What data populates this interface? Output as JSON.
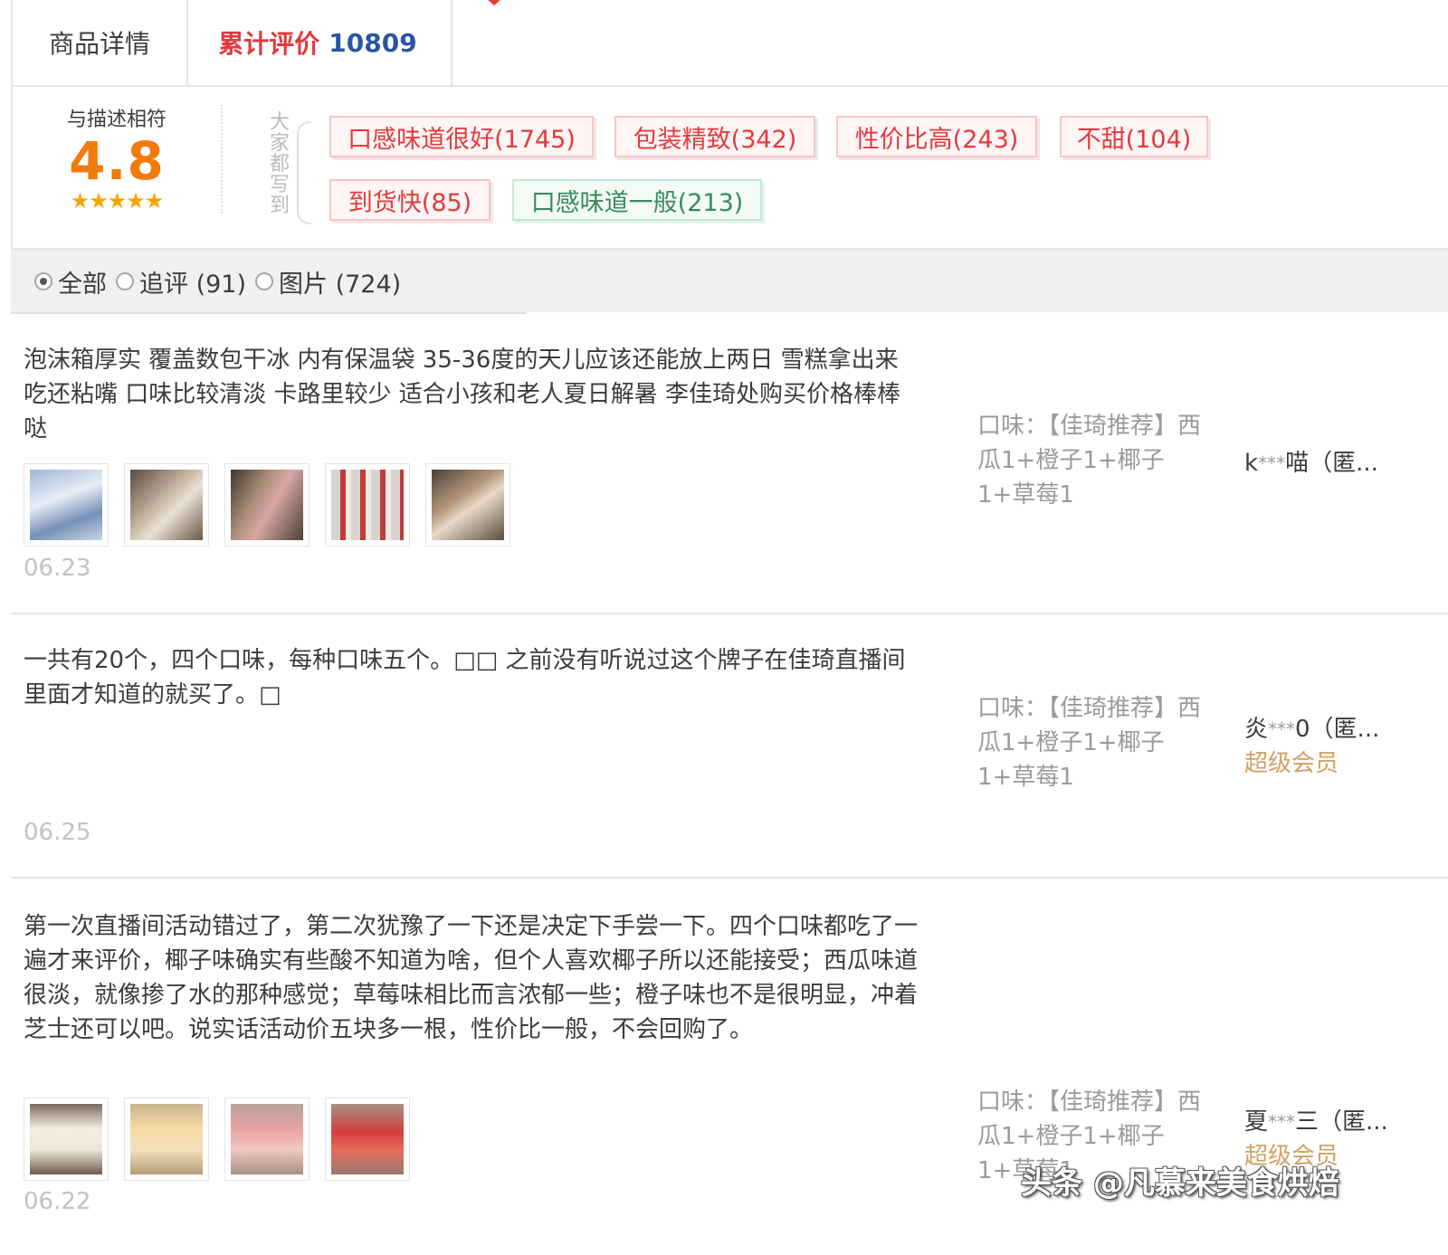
{
  "tabs": {
    "details_label": "商品详情",
    "reviews_label": "累计评价",
    "reviews_count": "10809"
  },
  "summary": {
    "score_label": "与描述相符",
    "score": "4.8",
    "stars": "★★★★★",
    "side_label": "大家都写到",
    "tags": [
      {
        "label": "口感味道很好(1745)",
        "sentiment": "positive"
      },
      {
        "label": "包装精致(342)",
        "sentiment": "positive"
      },
      {
        "label": "性价比高(243)",
        "sentiment": "positive"
      },
      {
        "label": "不甜(104)",
        "sentiment": "positive"
      },
      {
        "label": "到货快(85)",
        "sentiment": "positive"
      },
      {
        "label": "口感味道一般(213)",
        "sentiment": "neutral"
      }
    ]
  },
  "filter": {
    "options": [
      {
        "label": "全部",
        "selected": true
      },
      {
        "label": "追评 (91)",
        "selected": false
      },
      {
        "label": "图片 (724)",
        "selected": false
      }
    ]
  },
  "reviews": [
    {
      "text": "泡沫箱厚实 覆盖数包干冰 内有保温袋 35-36度的天儿应该还能放上两日 雪糕拿出来吃还粘嘴 口味比较清淡 卡路里较少 适合小孩和老人夏日解暑 李佳琦处购买价格棒棒哒",
      "date": "06.23",
      "sku_label": "口味：【佳琦推荐】西瓜1+橙子1+椰子1+草莓1",
      "user_name": "k",
      "user_mask": "***",
      "user_suffix": "喵（匿...",
      "member": ""
    },
    {
      "text": "一共有20个，四个口味，每种口味五个。□□ 之前没有听说过这个牌子在佳琦直播间里面才知道的就买了。□",
      "date": "06.25",
      "sku_label": "口味：【佳琦推荐】西瓜1+橙子1+椰子1+草莓1",
      "user_name": "炎",
      "user_mask": "***",
      "user_suffix": "0（匿...",
      "member": "超级会员"
    },
    {
      "text": "第一次直播间活动错过了，第二次犹豫了一下还是决定下手尝一下。四个口味都吃了一遍才来评价，椰子味确实有些酸不知道为啥，但个人喜欢椰子所以还能接受；西瓜味道很淡，就像掺了水的那种感觉；草莓味相比而言浓郁一些；橙子味也不是很明显，冲着芝士还可以吧。说实话活动价五块多一根，性价比一般，不会回购了。",
      "date": "06.22",
      "sku_label": "口味：【佳琦推荐】西瓜1+橙子1+椰子1+草莓1",
      "user_name": "夏",
      "user_mask": "***",
      "user_suffix": "三（匿...",
      "member": "超级会员"
    }
  ],
  "watermark": "头条 @凡慕来美食烘焙",
  "colors": {
    "accent_red": "#e4393c",
    "score_orange": "#f27a0b",
    "count_blue": "#2956a3",
    "vip_gold": "#d2a163"
  }
}
